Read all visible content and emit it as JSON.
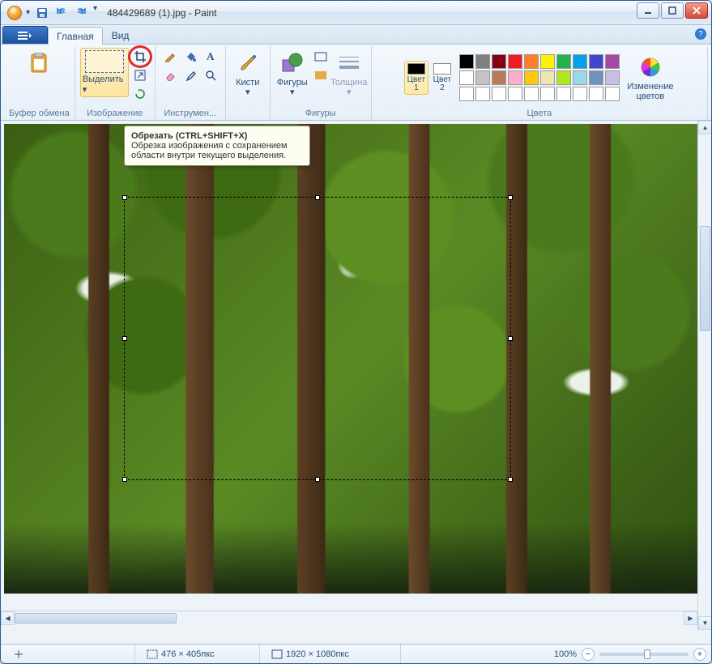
{
  "window": {
    "title": "484429689 (1).jpg - Paint"
  },
  "qat": {
    "save": "save-icon",
    "undo": "undo-icon",
    "redo": "redo-icon"
  },
  "tabs": {
    "file": "file",
    "home": "Главная",
    "view": "Вид"
  },
  "ribbon": {
    "clipboard": {
      "label": "Буфер обмена",
      "paste": "Вставить"
    },
    "image": {
      "label": "Изображение",
      "select": "Выделить",
      "crop_tooltip_title": "Обрезать (CTRL+SHIFT+X)",
      "crop_tooltip_body": "Обрезка изображения с сохранением области внутри текущего выделения."
    },
    "tools": {
      "label": "Инструмен..."
    },
    "brushes": {
      "label": "Кисти"
    },
    "shapes": {
      "label": "Фигуры",
      "shapes_btn": "Фигуры",
      "thickness": "Толщина"
    },
    "colors": {
      "label": "Цвета",
      "color1": "Цвет 1",
      "color2": "Цвет 2",
      "edit": "Изменение цветов",
      "primary": "#000000",
      "secondary": "#ffffff",
      "palette_row1": [
        "#000000",
        "#7f7f7f",
        "#880015",
        "#ed1c24",
        "#ff7f27",
        "#fff200",
        "#22b14c",
        "#00a2e8",
        "#3f48cc",
        "#a349a4"
      ],
      "palette_row2": [
        "#ffffff",
        "#c3c3c3",
        "#b97a57",
        "#ffaec9",
        "#ffc90e",
        "#efe4b0",
        "#b5e61d",
        "#99d9ea",
        "#7092be",
        "#c8bfe7"
      ],
      "palette_row3": [
        "#ffffff",
        "#ffffff",
        "#ffffff",
        "#ffffff",
        "#ffffff",
        "#ffffff",
        "#ffffff",
        "#ffffff",
        "#ffffff",
        "#ffffff"
      ]
    }
  },
  "status": {
    "pointer": "",
    "selection_size": "476 × 405пкс",
    "canvas_size": "1920 × 1080пкс",
    "zoom": "100%"
  }
}
